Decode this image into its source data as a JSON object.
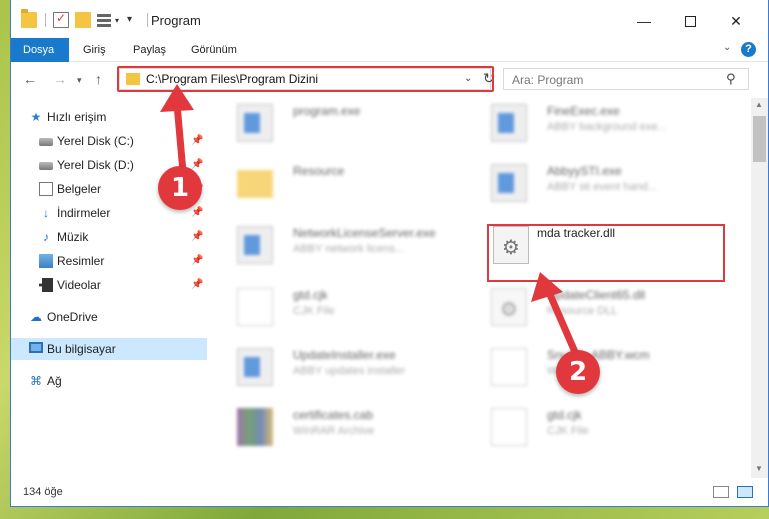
{
  "window": {
    "title": "Program",
    "minimize_icon": "—",
    "close_icon": "✕"
  },
  "ribbon": {
    "tabs": [
      {
        "label": "Dosya"
      },
      {
        "label": "Giriş"
      },
      {
        "label": "Paylaş"
      },
      {
        "label": "Görünüm"
      }
    ],
    "help_label": "?",
    "accent": "#1979ca"
  },
  "nav": {
    "back_icon": "←",
    "forward_icon": "→",
    "recent_icon": "▾",
    "up_icon": "↑",
    "address": "C:\\Program Files\\Program Dizini",
    "address_dropdown_icon": "⌄",
    "refresh_icon": "↻",
    "search_placeholder": "Ara: Program",
    "search_icon": "⚲"
  },
  "sidebar": {
    "items": [
      {
        "label": "Hızlı erişim",
        "icon": "★",
        "pin": ""
      },
      {
        "label": "Yerel Disk (C:)",
        "icon": "",
        "pin": "📌"
      },
      {
        "label": "Yerel Disk (D:)",
        "icon": "",
        "pin": "📌"
      },
      {
        "label": "Belgeler",
        "icon": "",
        "pin": "📌"
      },
      {
        "label": "İndirmeler",
        "icon": "↓",
        "pin": "📌"
      },
      {
        "label": "Müzik",
        "icon": "♪",
        "pin": "📌"
      },
      {
        "label": "Resimler",
        "icon": "",
        "pin": "📌"
      },
      {
        "label": "Videolar",
        "icon": "",
        "pin": "📌"
      },
      {
        "label": "OneDrive",
        "icon": "☁",
        "pin": ""
      },
      {
        "label": "Bu bilgisayar",
        "icon": "",
        "pin": ""
      },
      {
        "label": "Ağ",
        "icon": "⌘",
        "pin": ""
      }
    ]
  },
  "files": [
    {
      "name": "program.exe",
      "desc": ""
    },
    {
      "name": "FineExec.exe",
      "desc": "ABBY background exe..."
    },
    {
      "name": "Resource",
      "desc": ""
    },
    {
      "name": "AbbyySTI.exe",
      "desc": "ABBY sti event hand..."
    },
    {
      "name": "NetworkLicenseServer.exe",
      "desc": "ABBY network licens..."
    },
    {
      "name": "mda tracker.dll",
      "desc": ""
    },
    {
      "name": "gtd.cjk",
      "desc": "CJK File"
    },
    {
      "name": "UpdateClient65.dll",
      "desc": "Resource DLL"
    },
    {
      "name": "UpdateInstaller.exe",
      "desc": "ABBY updates installer"
    },
    {
      "name": "SnuTo...ABBY.wcm",
      "desc": "WCM File"
    },
    {
      "name": "certificates.cab",
      "desc": "WinRAR Archive"
    },
    {
      "name": "gtd.cjk",
      "desc": "CJK File"
    }
  ],
  "status": {
    "count": "134 öğe"
  },
  "annotations": {
    "step1": "1",
    "step2": "2",
    "color": "#e0383c"
  }
}
